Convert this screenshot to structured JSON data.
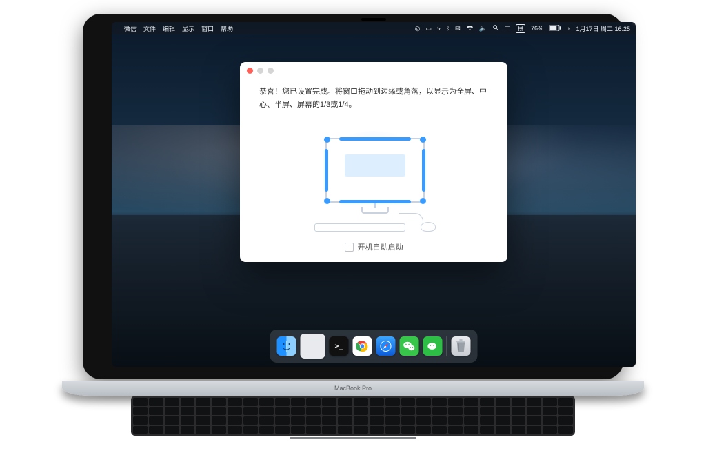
{
  "laptop_label": "MacBook Pro",
  "menubar": {
    "apple": "",
    "items": [
      "微信",
      "文件",
      "编辑",
      "显示",
      "窗口",
      "帮助"
    ],
    "status": {
      "input_method": "拼",
      "battery": "76%",
      "date_time": "1月17日 周二  16:25"
    }
  },
  "dialog": {
    "message": "恭喜！您已设置完成。将窗口拖动到边缘或角落，以显示为全屏、中心、半屏、屏幕的1/3或1/4。",
    "checkbox_label": "开机自动启动"
  },
  "dock": {
    "items": [
      "finder",
      "launchpad",
      "terminal",
      "chrome",
      "safari",
      "wechat",
      "wechat-work"
    ],
    "trash": "trash"
  }
}
